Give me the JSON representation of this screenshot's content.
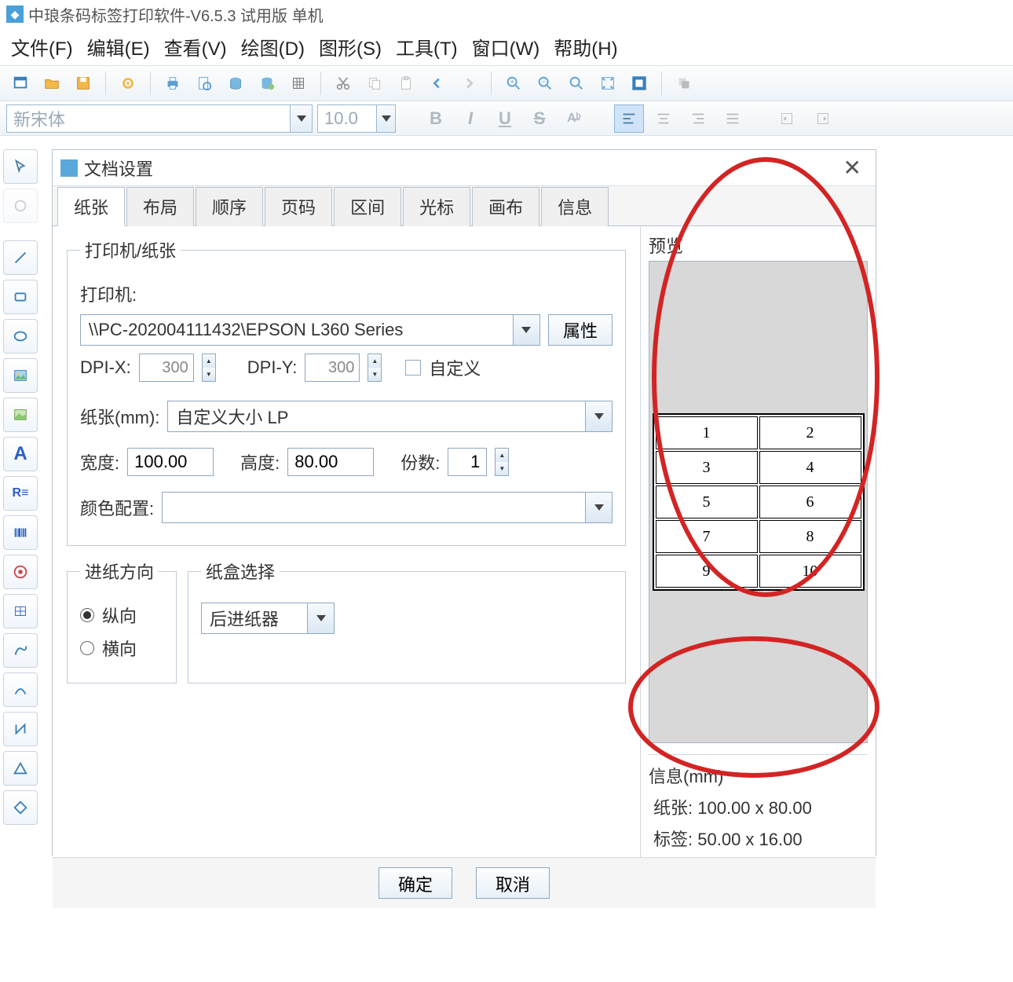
{
  "app": {
    "title": "中琅条码标签打印软件-V6.5.3 试用版 单机"
  },
  "menu": {
    "file": "文件(F)",
    "edit": "编辑(E)",
    "view": "查看(V)",
    "draw": "绘图(D)",
    "shape": "图形(S)",
    "tool": "工具(T)",
    "window": "窗口(W)",
    "help": "帮助(H)"
  },
  "fontbar": {
    "font": "新宋体",
    "size": "10.0"
  },
  "dialog": {
    "title": "文档设置",
    "tabs": [
      "纸张",
      "布局",
      "顺序",
      "页码",
      "区间",
      "光标",
      "画布",
      "信息"
    ],
    "section_printer": "打印机/纸张",
    "printer_label": "打印机:",
    "printer_value": "\\\\PC-202004111432\\EPSON L360 Series",
    "properties_btn": "属性",
    "dpix_label": "DPI-X:",
    "dpix_value": "300",
    "dpiy_label": "DPI-Y:",
    "dpiy_value": "300",
    "custom_label": "自定义",
    "paper_label": "纸张(mm):",
    "paper_value": "自定义大小 LP",
    "width_label": "宽度:",
    "width_value": "100.00",
    "height_label": "高度:",
    "height_value": "80.00",
    "copies_label": "份数:",
    "copies_value": "1",
    "color_label": "颜色配置:",
    "feed_dir_label": "进纸方向",
    "portrait": "纵向",
    "landscape": "横向",
    "tray_label": "纸盒选择",
    "tray_value": "后进纸器",
    "ok": "确定",
    "cancel": "取消",
    "preview_label": "预览",
    "info_label": "信息(mm)",
    "info_paper_label": "纸张:",
    "info_paper_value": "100.00 x 80.00",
    "info_tag_label": "标签:",
    "info_tag_value": "50.00 x 16.00",
    "preview_cells": [
      "1",
      "2",
      "3",
      "4",
      "5",
      "6",
      "7",
      "8",
      "9",
      "10"
    ]
  }
}
